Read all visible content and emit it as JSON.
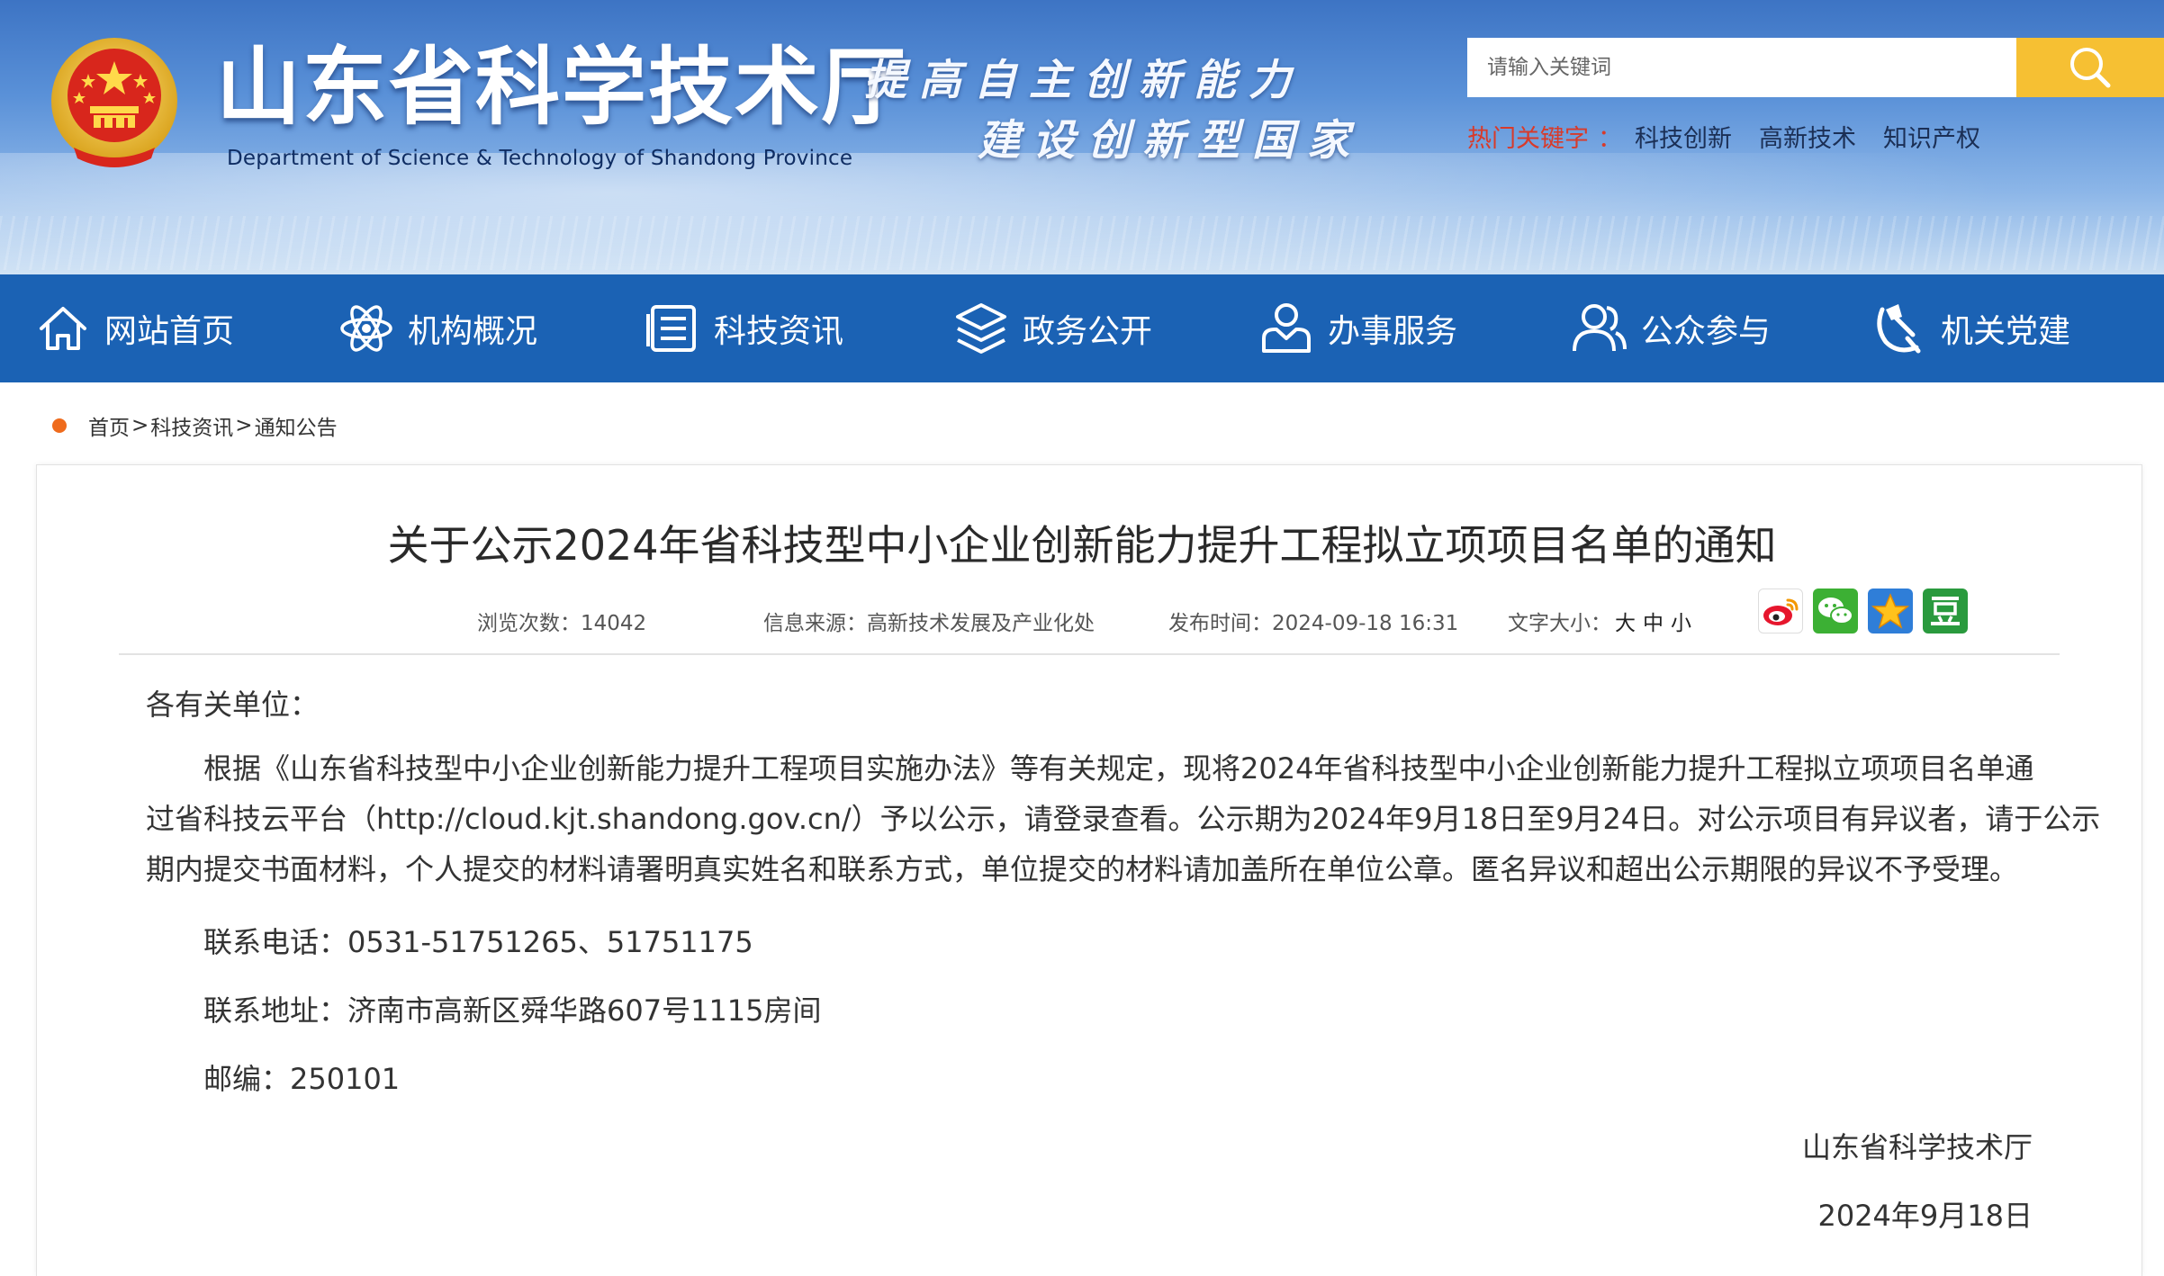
{
  "header": {
    "site_title": "山东省科学技术厅",
    "site_subtitle": "Department of Science & Technology of Shandong Province",
    "slogan_line1": "提高自主创新能力",
    "slogan_line2": "建设创新型国家",
    "search_placeholder": "请输入关键词",
    "hot_label": "热门关键字",
    "hot_sep": "：",
    "hot_keywords": [
      "科技创新",
      "高新技术",
      "知识产权"
    ],
    "colors": {
      "banner": "#4a82cf",
      "search_button": "#f6c033",
      "hot_label": "#d83a2a"
    }
  },
  "nav": {
    "items": [
      {
        "label": "网站首页",
        "icon": "home-icon"
      },
      {
        "label": "机构概况",
        "icon": "atom-icon"
      },
      {
        "label": "科技资讯",
        "icon": "news-list-icon"
      },
      {
        "label": "政务公开",
        "icon": "layers-icon"
      },
      {
        "label": "办事服务",
        "icon": "person-service-icon"
      },
      {
        "label": "公众参与",
        "icon": "people-icon"
      },
      {
        "label": "机关党建",
        "icon": "party-emblem-icon"
      }
    ],
    "color": "#1b62b4"
  },
  "breadcrumb": {
    "items": [
      "首页",
      "科技资讯",
      "通知公告"
    ],
    "separator": ">"
  },
  "article": {
    "title": "关于公示2024年省科技型中小企业创新能力提升工程拟立项项目名单的通知",
    "meta": {
      "views_label": "浏览次数：",
      "views": "14042",
      "source_label": "信息来源：",
      "source": "高新技术发展及产业化处",
      "time_label": "发布时间：",
      "time": "2024-09-18 16:31",
      "fontsize_label": "文字大小：",
      "fontsize_options": [
        "大",
        "中",
        "小"
      ]
    },
    "share_icons": [
      "weibo-icon",
      "wechat-icon",
      "qzone-star-icon",
      "douban-icon"
    ],
    "salutation": "各有关单位：",
    "paragraph_lines": [
      "　　根据《山东省科技型中小企业创新能力提升工程项目实施办法》等有关规定，现将2024年省科技型中小企业创新能力提升工程拟立项项目名单通",
      "过省科技云平台（http://cloud.kjt.shandong.gov.cn/）予以公示，请登录查看。公示期为2024年9月18日至9月24日。对公示项目有异议者，请于公示",
      "期内提交书面材料，个人提交的材料请署明真实姓名和联系方式，单位提交的材料请加盖所在单位公章。匿名异议和超出公示期限的异议不予受理。"
    ],
    "phone": "联系电话：0531-51751265、51751175",
    "address": "联系地址：济南市高新区舜华路607号1115房间",
    "postcode": "邮编：250101",
    "signature": "山东省科学技术厅",
    "date": "2024年9月18日"
  }
}
